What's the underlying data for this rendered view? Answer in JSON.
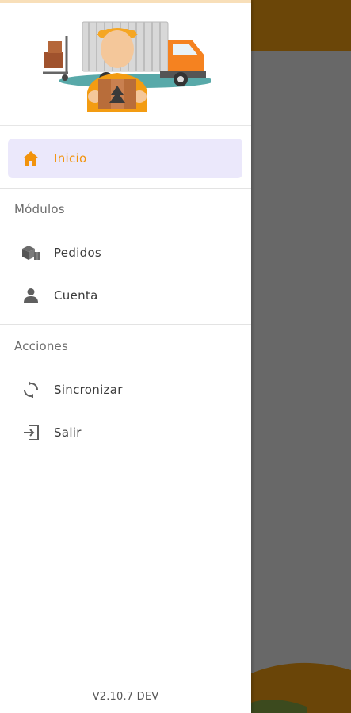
{
  "colors": {
    "accent": "#f2930c",
    "active_bg": "#ebe8fb",
    "background_app_topbar": "#6b4608",
    "background_overlay": "#686868"
  },
  "drawer": {
    "header_image": "delivery-man-truck-illustration",
    "items": [
      {
        "label": "Inicio",
        "icon": "home-icon",
        "active": true
      }
    ],
    "sections": [
      {
        "title": "Módulos",
        "items": [
          {
            "label": "Pedidos",
            "icon": "boxes-icon"
          },
          {
            "label": "Cuenta",
            "icon": "person-icon"
          }
        ]
      },
      {
        "title": "Acciones",
        "items": [
          {
            "label": "Sincronizar",
            "icon": "sync-icon"
          },
          {
            "label": "Salir",
            "icon": "logout-icon"
          }
        ]
      }
    ],
    "version": "V2.10.7 DEV"
  }
}
